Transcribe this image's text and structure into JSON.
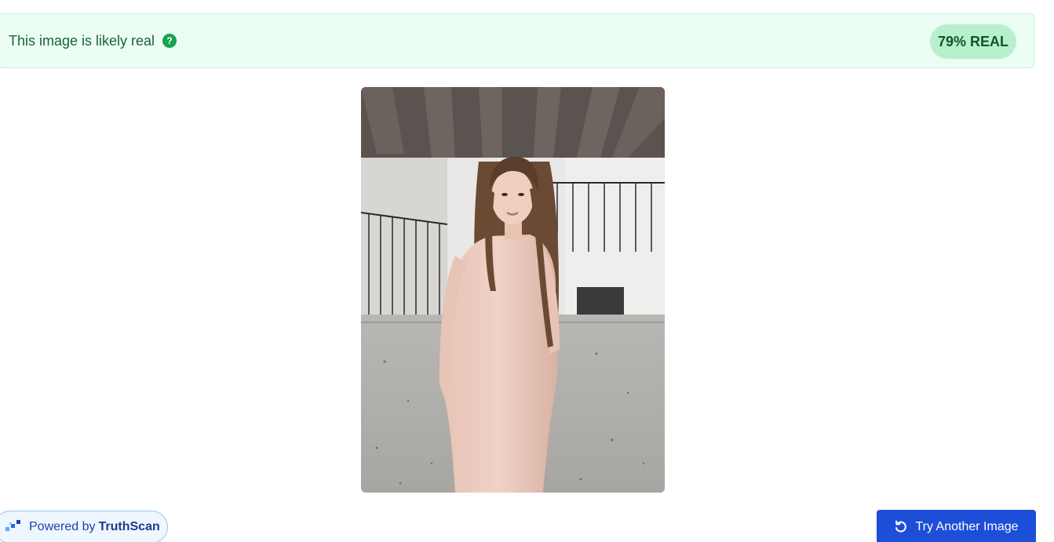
{
  "result": {
    "message": "This image is likely real",
    "help_icon": "question-mark-icon",
    "score_label": "79% REAL",
    "colors": {
      "banner_bg": "#ecfdf3",
      "text": "#166534",
      "badge_bg": "#b7f0cd"
    }
  },
  "analyzed_image": {
    "subject": "photo",
    "icon": "image-preview"
  },
  "footer": {
    "powered_prefix": "Powered by",
    "powered_brand": "TruthScan",
    "logo_icon": "truthscan-logo-icon",
    "try_label": "Try Another Image",
    "try_icon": "refresh-icon",
    "accent": "#1d4ed8"
  }
}
